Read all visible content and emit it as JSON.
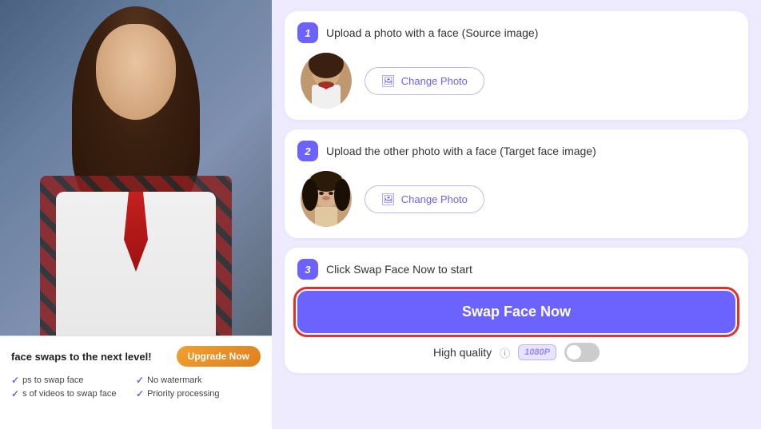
{
  "left": {
    "upgrade_title": "face swaps to the next level!",
    "upgrade_btn": "Upgrade Now",
    "features": [
      {
        "text": "ps to swap face"
      },
      {
        "text": "No watermark"
      },
      {
        "text": "s of videos to swap face"
      },
      {
        "text": "Priority processing"
      }
    ]
  },
  "steps": [
    {
      "number": "1",
      "title": "Upload a photo with a face (Source image)",
      "change_btn": "Change Photo"
    },
    {
      "number": "2",
      "title": "Upload the other photo with a face (Target face image)",
      "change_btn": "Change Photo"
    },
    {
      "number": "3",
      "title": "Click Swap Face Now to start",
      "swap_btn": "Swap Face Now",
      "quality_label": "High quality",
      "resolution": "1080P"
    }
  ]
}
